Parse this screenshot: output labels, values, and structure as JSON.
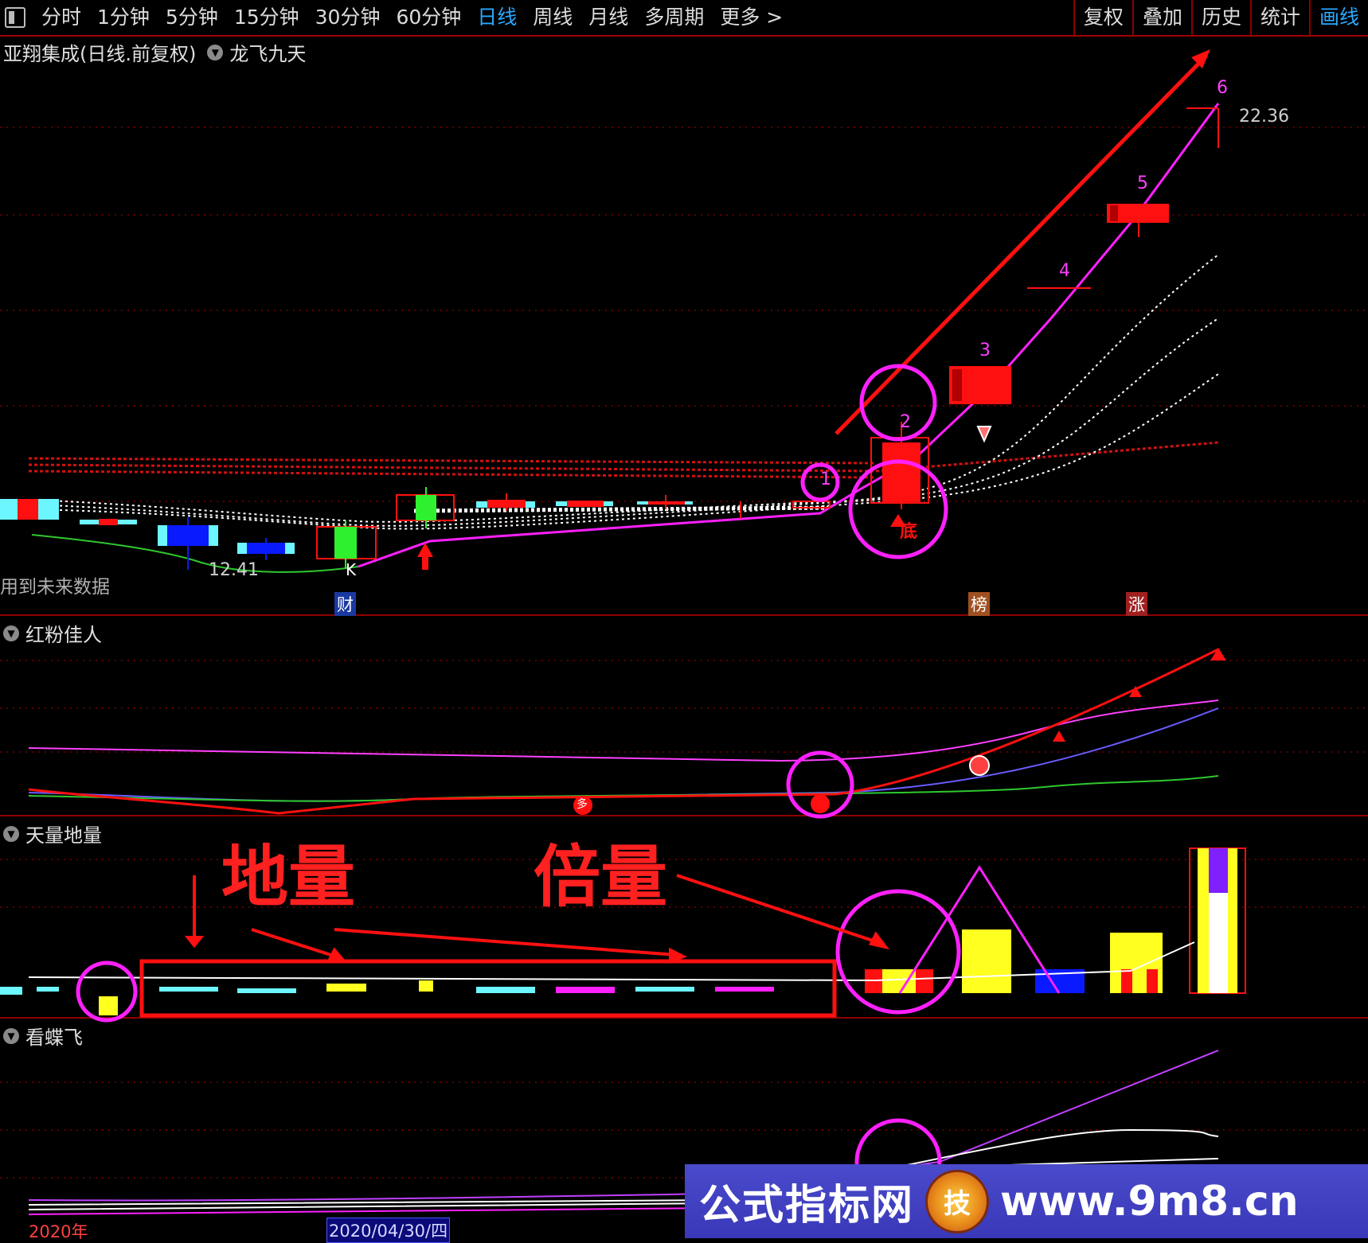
{
  "toolbar": {
    "periods": [
      "分时",
      "1分钟",
      "5分钟",
      "15分钟",
      "30分钟",
      "60分钟",
      "日线",
      "周线",
      "月线",
      "多周期",
      "更多 >"
    ],
    "active_period": "日线",
    "right_buttons": [
      "复权",
      "叠加",
      "历史",
      "统计",
      "画线"
    ],
    "active_right": "画线"
  },
  "main_panel": {
    "title": "亚翔集成(日线.前复权)",
    "indicator": "龙飞九天",
    "low_label": "12.41",
    "high_label": "22.36",
    "future_note": "用到未来数据",
    "wave_numbers": [
      "1",
      "2",
      "3",
      "4",
      "5",
      "6"
    ],
    "bottom_marker": "底",
    "k_marker": "K",
    "badges": [
      "财",
      "榜",
      "涨"
    ]
  },
  "panel2": {
    "title": "红粉佳人",
    "marker": "多"
  },
  "panel3": {
    "title": "天量地量",
    "annotation_low": "地量",
    "annotation_double": "倍量"
  },
  "panel4": {
    "title": "看蝶飞"
  },
  "date_axis": {
    "year": "2020年",
    "date": "2020/04/30/四"
  },
  "watermark": {
    "brand": "公式指标网",
    "logo_char": "技",
    "url": "www.9m8.cn"
  },
  "colors": {
    "accent_blue": "#2aa8ff",
    "bull_red": "#ff1010",
    "bear_blue": "#0a1aff",
    "magenta": "#ff20ff",
    "divider": "#900000"
  }
}
